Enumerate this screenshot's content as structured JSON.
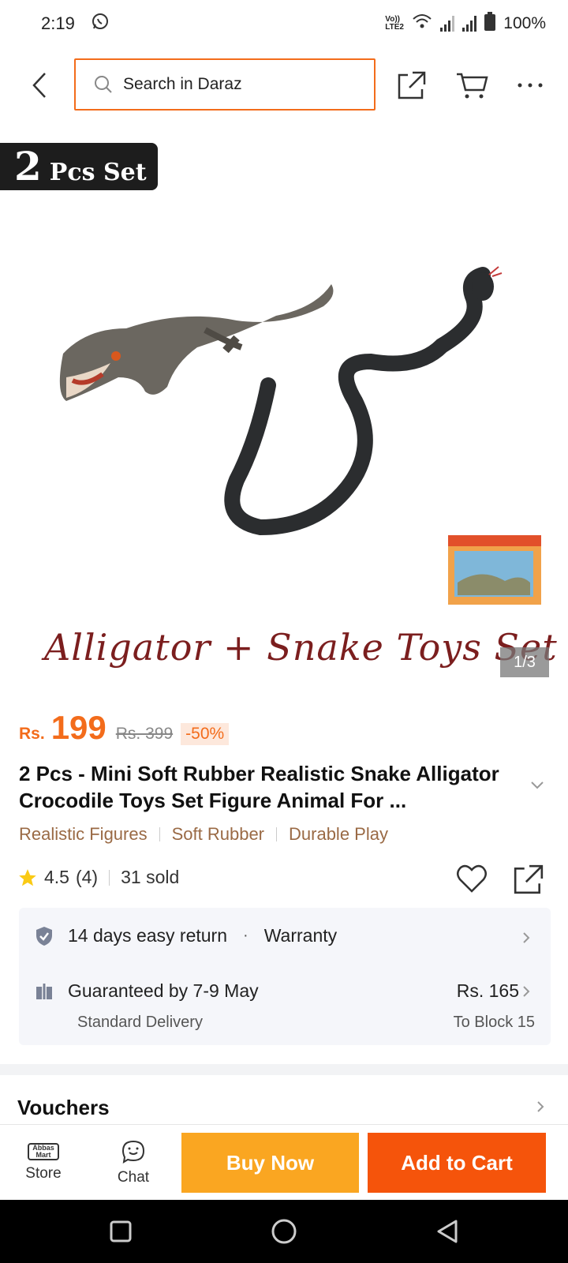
{
  "status_bar": {
    "time": "2:19",
    "network_label": "Vo)) LTE2",
    "battery": "100%"
  },
  "top_nav": {
    "search_placeholder": "Search in Daraz"
  },
  "product_image": {
    "badge_number": "2",
    "badge_text": "Pcs Set",
    "caption": "Alligator + Snake Toys Set",
    "counter": "1/3"
  },
  "price": {
    "currency": "Rs.",
    "amount": "199",
    "original": "Rs. 399",
    "discount": "-50%"
  },
  "product": {
    "title": "2 Pcs - Mini Soft Rubber Realistic Snake Alligator Crocodile Toys Set Figure Animal For ...",
    "tags": [
      "Realistic Figures",
      "Soft Rubber",
      "Durable Play"
    ],
    "rating": "4.5",
    "rating_count": "(4)",
    "sold": "31 sold"
  },
  "info": {
    "return_policy": "14 days easy return",
    "warranty": "Warranty",
    "delivery_guarantee": "Guaranteed by 7-9 May",
    "delivery_type": "Standard Delivery",
    "delivery_fee": "Rs. 165",
    "destination": "To Block 15"
  },
  "sections": {
    "vouchers": "Vouchers"
  },
  "action_bar": {
    "store_label": "Store",
    "store_logo": "Abbas Mart",
    "chat_label": "Chat",
    "buy_now": "Buy Now",
    "add_to_cart": "Add to Cart"
  },
  "colors": {
    "accent": "#f36c1b",
    "buy_now": "#faa621",
    "add_to_cart": "#f5540b",
    "tag_text": "#9a6a45"
  }
}
